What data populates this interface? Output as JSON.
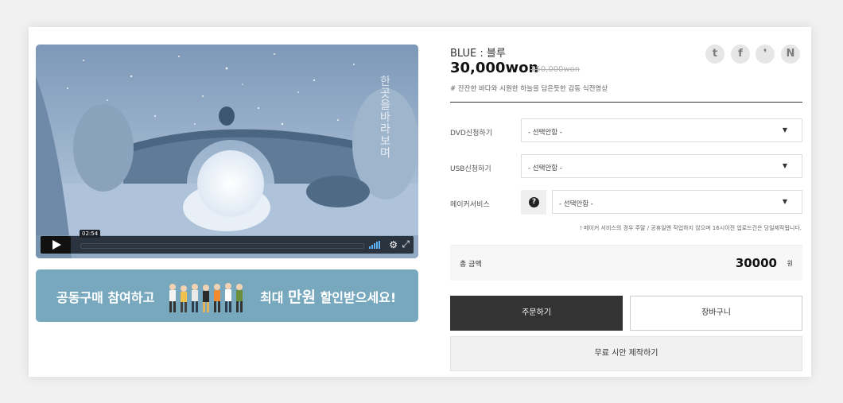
{
  "video": {
    "overlay_title": "한 곳을 바라보며",
    "timecode": "02:54",
    "controls": {
      "play": "play-icon",
      "volume": "volume-bars-icon",
      "settings": "gear-icon",
      "fullscreen": "fullscreen-icon"
    }
  },
  "banner": {
    "text_left": "공동구매 참여하고",
    "text_right_prefix": "최대",
    "text_right_emphasis": "만원",
    "text_right_suffix": "할인받으세요!"
  },
  "product": {
    "title": "BLUE : 블루",
    "price": "30,000won",
    "original_price": "150,000won",
    "description": "# 잔잔한 바다와 시원한 하늘을 담은듯한 감동 식전영상"
  },
  "share": {
    "twitter": "t",
    "facebook": "f",
    "kakao": "❜",
    "naver": "N"
  },
  "options": [
    {
      "label": "DVD신청하기",
      "value": "- 선택안함 -"
    },
    {
      "label": "USB신청하기",
      "value": "- 선택안함 -"
    },
    {
      "label": "메이커서비스",
      "value": "- 선택안함 -"
    }
  ],
  "help_icon": "?",
  "notice": "! 메이커 서비스의 경우 주말 / 공휴일엔 작업하지 않으며 16시이전 업로드건은 당일제작됩니다.",
  "total": {
    "label": "총 금액",
    "value": "30000",
    "unit": "원"
  },
  "buttons": {
    "order": "주문하기",
    "cart": "장바구니",
    "trial": "무료 시안 제작하기"
  },
  "colors": {
    "accent_dark": "#333333",
    "video_volume": "#5db3ff",
    "banner_bg": "#77a8bd"
  }
}
